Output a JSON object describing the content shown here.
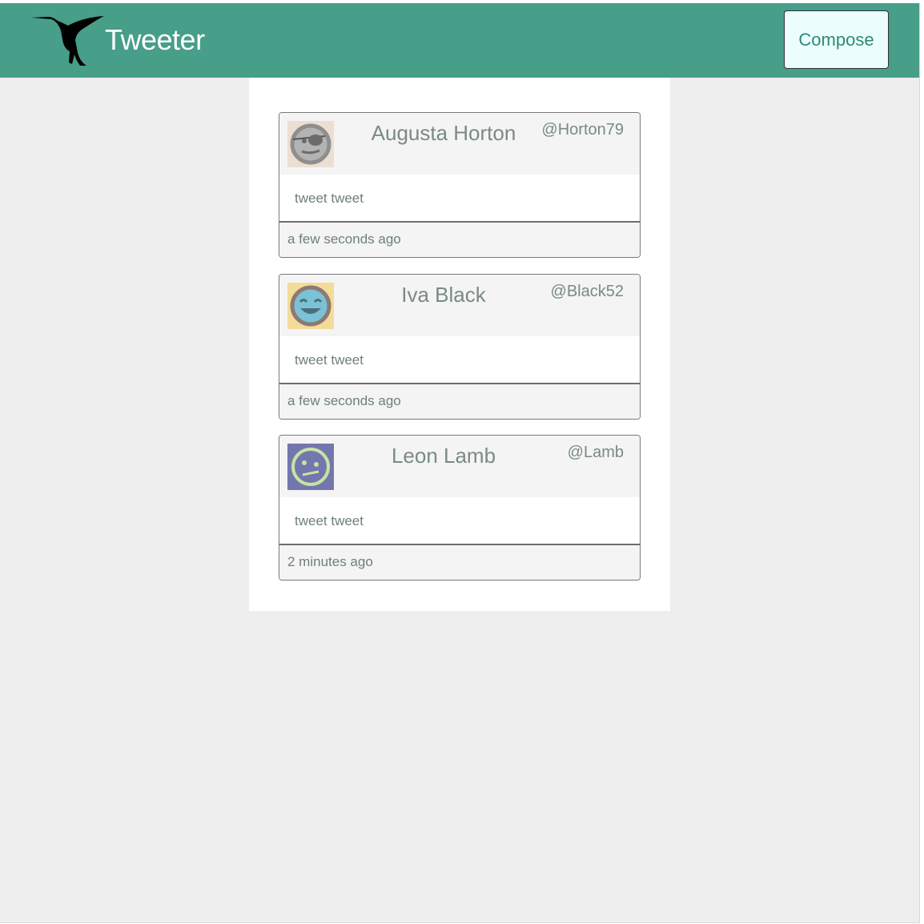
{
  "header": {
    "logo_icon": "hummingbird-icon",
    "title": "Tweeter",
    "compose_label": "Compose"
  },
  "colors": {
    "navbar": "#479e89",
    "page_background": "#eeeeee",
    "compose_text": "#2f8a78"
  },
  "tweets": [
    {
      "name": "Augusta Horton",
      "handle": "@Horton79",
      "text": "tweet tweet",
      "time": "a few seconds ago",
      "avatar": "pirate-face-avatar-icon"
    },
    {
      "name": "Iva Black",
      "handle": "@Black52",
      "text": "tweet tweet",
      "time": "a few seconds ago",
      "avatar": "laughing-face-avatar-icon"
    },
    {
      "name": "Leon Lamb",
      "handle": "@Lamb",
      "text": "tweet tweet",
      "time": "2 minutes ago",
      "avatar": "confused-face-avatar-icon"
    }
  ]
}
